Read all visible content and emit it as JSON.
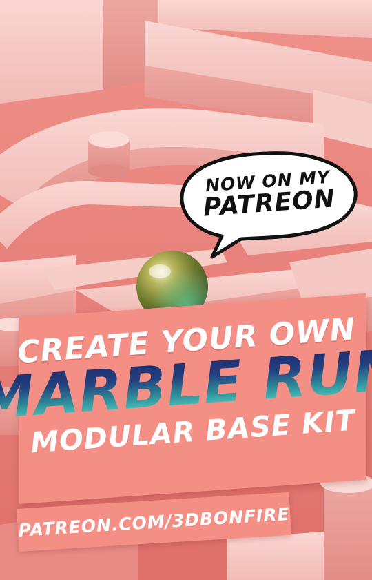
{
  "bubble": {
    "line1": "NOW ON MY",
    "line2": "PATREON"
  },
  "banner": {
    "line1": "CREATE YOUR OWN",
    "line2": "MARBLE RUN",
    "line3": "MODULAR BASE KIT"
  },
  "footer": {
    "url": "PATREON.COM/3DBONFIRE"
  },
  "colors": {
    "background": "#e8817a",
    "block": "#f3c4c0",
    "banner": "#f48f86",
    "title_gradient_top": "#1e2a6b",
    "title_gradient_bottom": "#5fe3cf",
    "marble": "#8a8a3a"
  }
}
